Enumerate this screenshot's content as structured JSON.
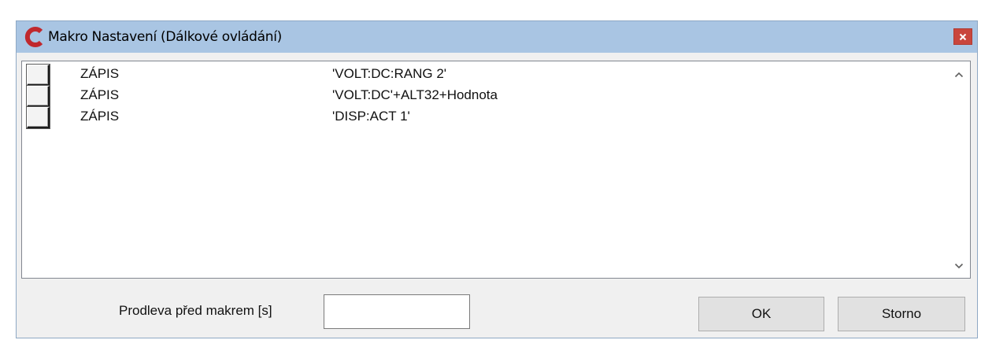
{
  "window": {
    "title": "Makro Nastavení (Dálkové ovládání)",
    "icon": "red-c-logo-icon",
    "close_symbol": "x"
  },
  "macro_list": {
    "rows": [
      {
        "checked": false,
        "command": "ZÁPIS",
        "value": "'VOLT:DC:RANG 2'"
      },
      {
        "checked": false,
        "command": "ZÁPIS",
        "value": "'VOLT:DC'+ALT32+Hodnota"
      },
      {
        "checked": false,
        "command": "ZÁPIS",
        "value": "'DISP:ACT 1'"
      }
    ],
    "scroll_up_icon": "chevron-up-icon",
    "scroll_down_icon": "chevron-down-icon"
  },
  "footer": {
    "delay_label": "Prodleva před makrem [s]",
    "delay_value": "",
    "ok_label": "OK",
    "cancel_label": "Storno"
  },
  "colors": {
    "titlebar": "#a9c5e3",
    "close_button": "#c9463d",
    "logo": "#c0282d"
  }
}
